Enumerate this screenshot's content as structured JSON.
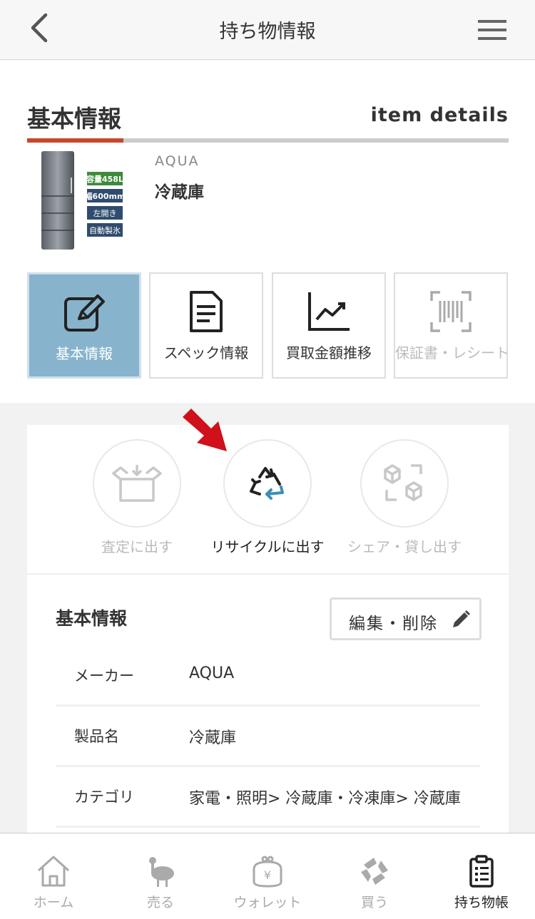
{
  "header": {
    "title": "持ち物情報"
  },
  "section": {
    "title": "基本情報",
    "title_en": "item details"
  },
  "product": {
    "brand": "AQUA",
    "name": "冷蔵庫",
    "badges": [
      "容量458L",
      "幅600mm",
      "左開き",
      "自動製氷"
    ]
  },
  "tiles": [
    {
      "label": "基本情報",
      "icon": "edit-icon"
    },
    {
      "label": "スペック情報",
      "icon": "document-icon"
    },
    {
      "label": "買取金額推移",
      "icon": "chart-icon"
    },
    {
      "label": "保証書・レシート",
      "icon": "barcode-icon"
    }
  ],
  "actions": [
    {
      "label": "査定に出す",
      "icon": "box-icon"
    },
    {
      "label": "リサイクルに出す",
      "icon": "recycle-icon"
    },
    {
      "label": "シェア・貸し出す",
      "icon": "share-icon"
    }
  ],
  "info": {
    "title": "基本情報",
    "edit_label": "編集・削除",
    "rows": [
      {
        "key": "メーカー",
        "value": "AQUA"
      },
      {
        "key": "製品名",
        "value": "冷蔵庫"
      },
      {
        "key": "カテゴリ",
        "value": "家電・照明> 冷蔵庫・冷凍庫> 冷蔵庫"
      }
    ]
  },
  "tabbar": [
    {
      "label": "ホーム",
      "icon": "home-icon"
    },
    {
      "label": "売る",
      "icon": "ostrich-icon"
    },
    {
      "label": "ウォレット",
      "icon": "wallet-icon"
    },
    {
      "label": "買う",
      "icon": "shop-icon"
    },
    {
      "label": "持ち物帳",
      "icon": "clipboard-icon"
    }
  ],
  "colors": {
    "accent": "#c8472c",
    "active_tile": "#87b3cd",
    "arrow": "#d0101a",
    "recycle_blue": "#3a8fb5"
  }
}
